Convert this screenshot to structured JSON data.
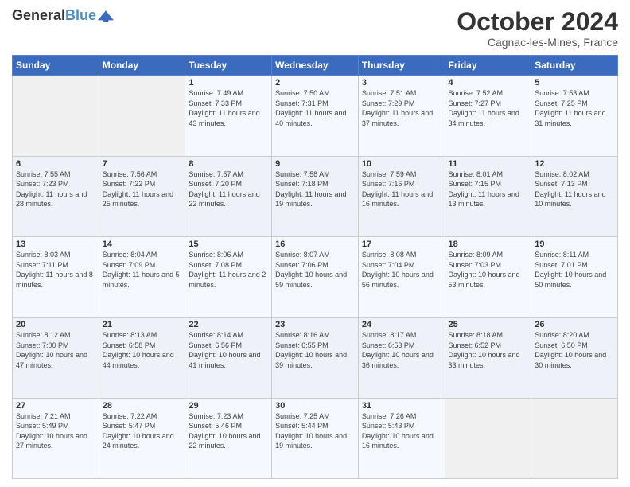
{
  "header": {
    "logo_line1": "General",
    "logo_line2": "Blue",
    "title": "October 2024",
    "subtitle": "Cagnac-les-Mines, France"
  },
  "days_of_week": [
    "Sunday",
    "Monday",
    "Tuesday",
    "Wednesday",
    "Thursday",
    "Friday",
    "Saturday"
  ],
  "weeks": [
    [
      {
        "day": "",
        "info": ""
      },
      {
        "day": "",
        "info": ""
      },
      {
        "day": "1",
        "info": "Sunrise: 7:49 AM\nSunset: 7:33 PM\nDaylight: 11 hours and 43 minutes."
      },
      {
        "day": "2",
        "info": "Sunrise: 7:50 AM\nSunset: 7:31 PM\nDaylight: 11 hours and 40 minutes."
      },
      {
        "day": "3",
        "info": "Sunrise: 7:51 AM\nSunset: 7:29 PM\nDaylight: 11 hours and 37 minutes."
      },
      {
        "day": "4",
        "info": "Sunrise: 7:52 AM\nSunset: 7:27 PM\nDaylight: 11 hours and 34 minutes."
      },
      {
        "day": "5",
        "info": "Sunrise: 7:53 AM\nSunset: 7:25 PM\nDaylight: 11 hours and 31 minutes."
      }
    ],
    [
      {
        "day": "6",
        "info": "Sunrise: 7:55 AM\nSunset: 7:23 PM\nDaylight: 11 hours and 28 minutes."
      },
      {
        "day": "7",
        "info": "Sunrise: 7:56 AM\nSunset: 7:22 PM\nDaylight: 11 hours and 25 minutes."
      },
      {
        "day": "8",
        "info": "Sunrise: 7:57 AM\nSunset: 7:20 PM\nDaylight: 11 hours and 22 minutes."
      },
      {
        "day": "9",
        "info": "Sunrise: 7:58 AM\nSunset: 7:18 PM\nDaylight: 11 hours and 19 minutes."
      },
      {
        "day": "10",
        "info": "Sunrise: 7:59 AM\nSunset: 7:16 PM\nDaylight: 11 hours and 16 minutes."
      },
      {
        "day": "11",
        "info": "Sunrise: 8:01 AM\nSunset: 7:15 PM\nDaylight: 11 hours and 13 minutes."
      },
      {
        "day": "12",
        "info": "Sunrise: 8:02 AM\nSunset: 7:13 PM\nDaylight: 11 hours and 10 minutes."
      }
    ],
    [
      {
        "day": "13",
        "info": "Sunrise: 8:03 AM\nSunset: 7:11 PM\nDaylight: 11 hours and 8 minutes."
      },
      {
        "day": "14",
        "info": "Sunrise: 8:04 AM\nSunset: 7:09 PM\nDaylight: 11 hours and 5 minutes."
      },
      {
        "day": "15",
        "info": "Sunrise: 8:06 AM\nSunset: 7:08 PM\nDaylight: 11 hours and 2 minutes."
      },
      {
        "day": "16",
        "info": "Sunrise: 8:07 AM\nSunset: 7:06 PM\nDaylight: 10 hours and 59 minutes."
      },
      {
        "day": "17",
        "info": "Sunrise: 8:08 AM\nSunset: 7:04 PM\nDaylight: 10 hours and 56 minutes."
      },
      {
        "day": "18",
        "info": "Sunrise: 8:09 AM\nSunset: 7:03 PM\nDaylight: 10 hours and 53 minutes."
      },
      {
        "day": "19",
        "info": "Sunrise: 8:11 AM\nSunset: 7:01 PM\nDaylight: 10 hours and 50 minutes."
      }
    ],
    [
      {
        "day": "20",
        "info": "Sunrise: 8:12 AM\nSunset: 7:00 PM\nDaylight: 10 hours and 47 minutes."
      },
      {
        "day": "21",
        "info": "Sunrise: 8:13 AM\nSunset: 6:58 PM\nDaylight: 10 hours and 44 minutes."
      },
      {
        "day": "22",
        "info": "Sunrise: 8:14 AM\nSunset: 6:56 PM\nDaylight: 10 hours and 41 minutes."
      },
      {
        "day": "23",
        "info": "Sunrise: 8:16 AM\nSunset: 6:55 PM\nDaylight: 10 hours and 39 minutes."
      },
      {
        "day": "24",
        "info": "Sunrise: 8:17 AM\nSunset: 6:53 PM\nDaylight: 10 hours and 36 minutes."
      },
      {
        "day": "25",
        "info": "Sunrise: 8:18 AM\nSunset: 6:52 PM\nDaylight: 10 hours and 33 minutes."
      },
      {
        "day": "26",
        "info": "Sunrise: 8:20 AM\nSunset: 6:50 PM\nDaylight: 10 hours and 30 minutes."
      }
    ],
    [
      {
        "day": "27",
        "info": "Sunrise: 7:21 AM\nSunset: 5:49 PM\nDaylight: 10 hours and 27 minutes."
      },
      {
        "day": "28",
        "info": "Sunrise: 7:22 AM\nSunset: 5:47 PM\nDaylight: 10 hours and 24 minutes."
      },
      {
        "day": "29",
        "info": "Sunrise: 7:23 AM\nSunset: 5:46 PM\nDaylight: 10 hours and 22 minutes."
      },
      {
        "day": "30",
        "info": "Sunrise: 7:25 AM\nSunset: 5:44 PM\nDaylight: 10 hours and 19 minutes."
      },
      {
        "day": "31",
        "info": "Sunrise: 7:26 AM\nSunset: 5:43 PM\nDaylight: 10 hours and 16 minutes."
      },
      {
        "day": "",
        "info": ""
      },
      {
        "day": "",
        "info": ""
      }
    ]
  ]
}
